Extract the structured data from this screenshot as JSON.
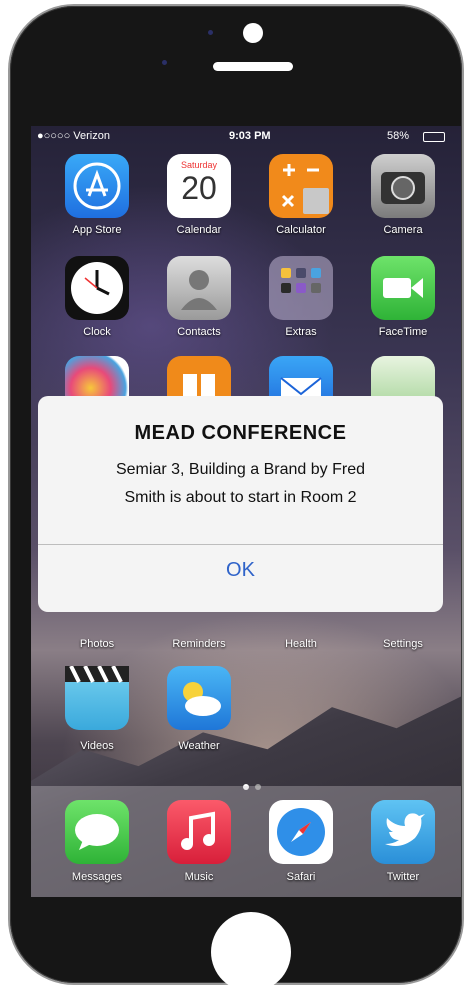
{
  "status_bar": {
    "carrier": "●○○○○ Verizon",
    "time": "9:03 PM",
    "battery": "58%"
  },
  "apps_row1": [
    {
      "label": "App Store",
      "icon": "app-store-icon"
    },
    {
      "label": "Calendar",
      "icon": "calendar-icon",
      "day": "Saturday",
      "date": "20"
    },
    {
      "label": "Calculator",
      "icon": "calculator-icon"
    },
    {
      "label": "Camera",
      "icon": "camera-icon"
    }
  ],
  "apps_row2": [
    {
      "label": "Clock",
      "icon": "clock-icon"
    },
    {
      "label": "Contacts",
      "icon": "contacts-icon"
    },
    {
      "label": "Extras",
      "icon": "folder-icon"
    },
    {
      "label": "FaceTime",
      "icon": "facetime-icon"
    }
  ],
  "apps_row4": [
    {
      "label": "Photos"
    },
    {
      "label": "Reminders"
    },
    {
      "label": "Health"
    },
    {
      "label": "Settings"
    }
  ],
  "apps_row5": [
    {
      "label": "Videos",
      "icon": "clapper-icon"
    },
    {
      "label": "Weather",
      "icon": "weather-icon"
    }
  ],
  "dock": [
    {
      "label": "Messages",
      "icon": "messages-icon"
    },
    {
      "label": "Music",
      "icon": "music-icon"
    },
    {
      "label": "Safari",
      "icon": "safari-icon"
    },
    {
      "label": "Twitter",
      "icon": "twitter-icon"
    }
  ],
  "alert": {
    "title": "MEAD CONFERENCE",
    "message_line1": "Semiar 3, Building a Brand by Fred",
    "message_line2": "Smith is about to start in Room 2",
    "ok": "OK"
  },
  "colors": {
    "alert_button": "#2f63c9",
    "phone_body": "#161616"
  }
}
